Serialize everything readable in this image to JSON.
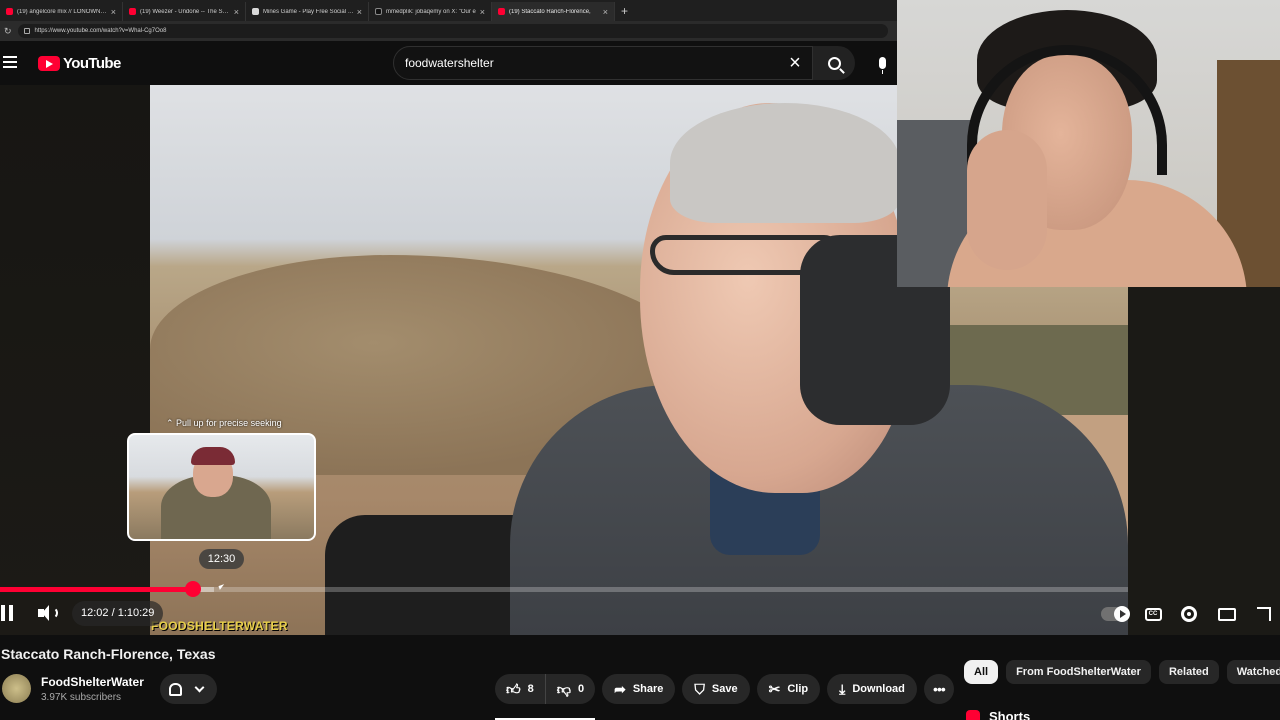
{
  "browser": {
    "tabs": [
      {
        "label": "(19) angelcore mix // LONOWN, al",
        "icon_color": "#ff0033"
      },
      {
        "label": "(19) Weezer - Undone -- The Swea",
        "icon_color": "#ff0033"
      },
      {
        "label": "Mines Game - Play Free Social Ca",
        "icon_color": "#d9d9d9"
      },
      {
        "label": "mmedplık: jobaqemy on X: \"Our e",
        "icon_color": "#111111"
      },
      {
        "label": "(19) Staccato Ranch-Florence,",
        "icon_color": "#ff0033"
      }
    ],
    "url": "https://www.youtube.com/watch?v=Whal-Cg7Oo8"
  },
  "header": {
    "logo_text": "YouTube",
    "search_value": "foodwatershelter"
  },
  "player": {
    "pull_up_hint": "Pull up for precise seeking",
    "preview_time": "12:30",
    "time_display": "12:02 / 1:10:29",
    "watermark": "FOODSHELTERWATER",
    "progress_fraction": 0.171,
    "buffer_fraction": 0.19
  },
  "video": {
    "title": "Staccato Ranch-Florence, Texas",
    "channel_name": "FoodShelterWater",
    "subscribers": "3.97K subscribers",
    "likes": "8",
    "dislikes": "0",
    "actions": {
      "share": "Share",
      "save": "Save",
      "clip": "Clip",
      "download": "Download"
    }
  },
  "chips": [
    "All",
    "From FoodShelterWater",
    "Related",
    "Watched"
  ],
  "shorts_label": "Shorts",
  "colors": {
    "accent": "#ff0033",
    "background": "#0f0f0f",
    "watermark": "#e8cf4a"
  }
}
